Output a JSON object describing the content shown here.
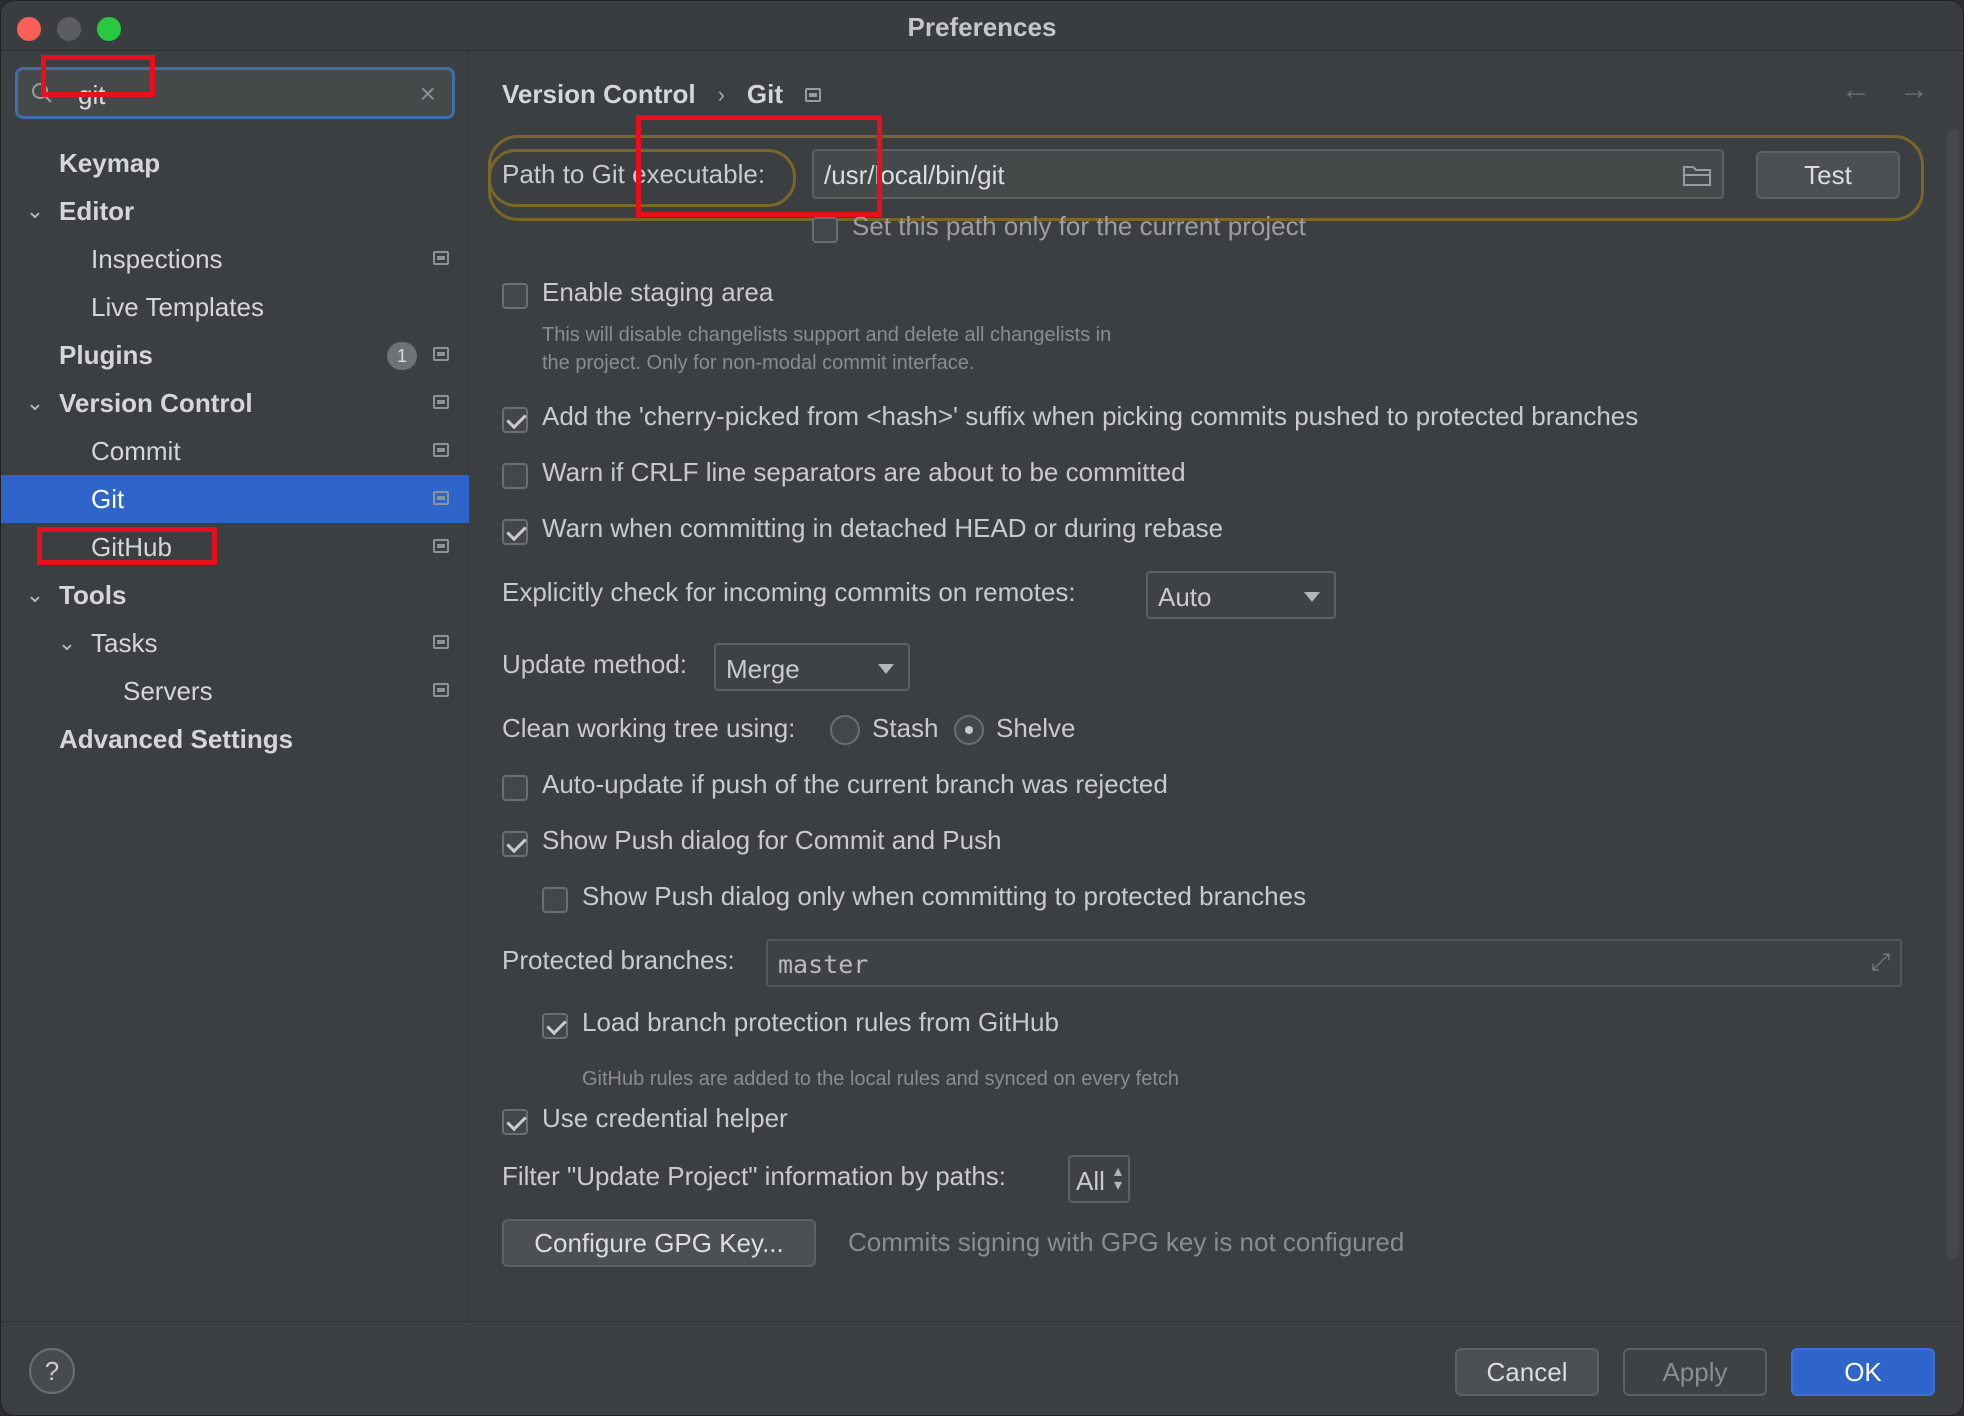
{
  "window": {
    "title": "Preferences"
  },
  "search": {
    "value": "git"
  },
  "sidebar": {
    "items": [
      {
        "label": "Keymap",
        "bold": true,
        "level": 0,
        "chevron": false,
        "icon": false
      },
      {
        "label": "Editor",
        "bold": true,
        "level": 0,
        "chevron": true,
        "icon": false
      },
      {
        "label": "Inspections",
        "bold": false,
        "level": 1,
        "chevron": false,
        "icon": true
      },
      {
        "label": "Live Templates",
        "bold": false,
        "level": 1,
        "chevron": false,
        "icon": false
      },
      {
        "label": "Plugins",
        "bold": true,
        "level": 0,
        "chevron": false,
        "icon": true,
        "badge": "1"
      },
      {
        "label": "Version Control",
        "bold": true,
        "level": 0,
        "chevron": true,
        "icon": true
      },
      {
        "label": "Commit",
        "bold": false,
        "level": 1,
        "chevron": false,
        "icon": true
      },
      {
        "label": "Git",
        "bold": false,
        "level": 1,
        "chevron": false,
        "icon": true,
        "selected": true
      },
      {
        "label": "GitHub",
        "bold": false,
        "level": 1,
        "chevron": false,
        "icon": true
      },
      {
        "label": "Tools",
        "bold": true,
        "level": 0,
        "chevron": true,
        "icon": false
      },
      {
        "label": "Tasks",
        "bold": false,
        "level": 1,
        "chevron": true,
        "icon": true
      },
      {
        "label": "Servers",
        "bold": false,
        "level": 2,
        "chevron": false,
        "icon": true
      },
      {
        "label": "Advanced Settings",
        "bold": true,
        "level": 0,
        "chevron": false,
        "icon": false
      }
    ]
  },
  "breadcrumb": {
    "parent": "Version Control",
    "separator": "›",
    "current": "Git"
  },
  "nav": {
    "back": "←",
    "forward": "→"
  },
  "git": {
    "path_label": "Path to Git executable:",
    "path_value": "/usr/local/bin/git",
    "test_button": "Test",
    "path_only_project": "Set this path only for the current project",
    "enable_staging": "Enable staging area",
    "staging_hint_1": "This will disable changelists support and delete all changelists in",
    "staging_hint_2": "the project. Only for non-modal commit interface.",
    "cherry_picked": "Add the 'cherry-picked from <hash>' suffix when picking commits pushed to protected branches",
    "warn_crlf": "Warn if CRLF line separators are about to be committed",
    "warn_detached": "Warn when committing in detached HEAD or during rebase",
    "incoming_label": "Explicitly check for incoming commits on remotes:",
    "incoming_value": "Auto",
    "update_method_label": "Update method:",
    "update_method_value": "Merge",
    "clean_tree_label": "Clean working tree using:",
    "stash_label": "Stash",
    "shelve_label": "Shelve",
    "auto_update": "Auto-update if push of the current branch was rejected",
    "show_push": "Show Push dialog for Commit and Push",
    "show_push_protected": "Show Push dialog only when committing to protected branches",
    "protected_label": "Protected branches:",
    "protected_value": "master",
    "load_rules": "Load branch protection rules from GitHub",
    "rules_hint": "GitHub rules are added to the local rules and synced on every fetch",
    "credential_helper": "Use credential helper",
    "filter_label": "Filter \"Update Project\" information by paths:",
    "filter_value": "All",
    "gpg_button": "Configure GPG Key...",
    "gpg_status": "Commits signing with GPG key is not configured"
  },
  "footer": {
    "help": "?",
    "cancel": "Cancel",
    "apply": "Apply",
    "ok": "OK"
  },
  "colors": {
    "accent": "#2f65ca",
    "highlight": "#e8101c",
    "focus_ring": "#7a6728"
  }
}
